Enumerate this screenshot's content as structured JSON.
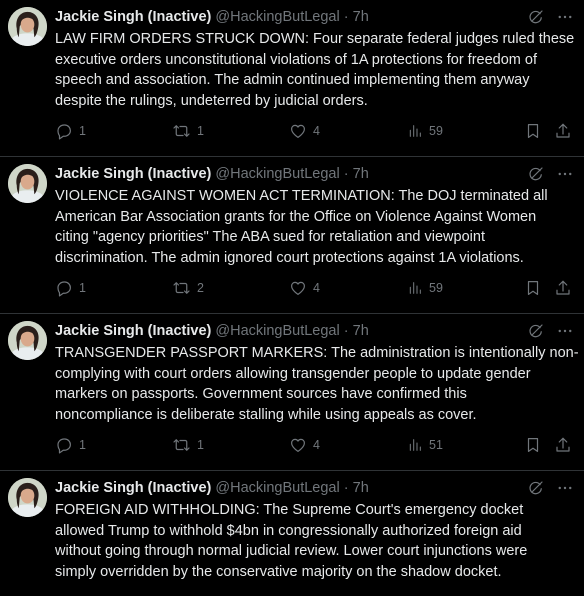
{
  "colors": {
    "background": "#000000",
    "text": "#e7e9ea",
    "muted": "#71767b",
    "divider": "#2f3336"
  },
  "tweets": [
    {
      "name": "Jackie Singh (Inactive)",
      "handle": "@HackingButLegal",
      "separator": "·",
      "time": "7h",
      "lines": [
        "LAW FIRM ORDERS STRUCK DOWN: Four separate federal judges ruled these",
        "executive orders unconstitutional violations of 1A protections for freedom of",
        "speech and association. The admin continued implementing them anyway",
        "despite the rulings, undeterred by judicial orders."
      ],
      "replies": "1",
      "reposts": "1",
      "likes": "4",
      "views": "59",
      "icons": [
        "grok-icon",
        "more-icon",
        "reply-icon",
        "repost-icon",
        "like-icon",
        "views-icon",
        "bookmark-icon",
        "share-icon"
      ]
    },
    {
      "name": "Jackie Singh (Inactive)",
      "handle": "@HackingButLegal",
      "separator": "·",
      "time": "7h",
      "lines": [
        "VIOLENCE AGAINST WOMEN ACT TERMINATION: The DOJ terminated all",
        "American Bar Association grants for the Office on Violence Against Women",
        "citing \"agency priorities\" The ABA sued for retaliation and viewpoint",
        "discrimination. The admin ignored court protections against 1A violations."
      ],
      "replies": "1",
      "reposts": "2",
      "likes": "4",
      "views": "59",
      "icons": [
        "grok-icon",
        "more-icon",
        "reply-icon",
        "repost-icon",
        "like-icon",
        "views-icon",
        "bookmark-icon",
        "share-icon"
      ]
    },
    {
      "name": "Jackie Singh (Inactive)",
      "handle": "@HackingButLegal",
      "separator": "·",
      "time": "7h",
      "lines": [
        "TRANSGENDER PASSPORT MARKERS: The administration is intentionally non-",
        "complying with court orders allowing transgender people to update gender",
        "markers on passports. Government sources have confirmed this",
        "noncompliance is deliberate stalling while using appeals as cover."
      ],
      "replies": "1",
      "reposts": "1",
      "likes": "4",
      "views": "51",
      "icons": [
        "grok-icon",
        "more-icon",
        "reply-icon",
        "repost-icon",
        "like-icon",
        "views-icon",
        "bookmark-icon",
        "share-icon"
      ]
    },
    {
      "name": "Jackie Singh (Inactive)",
      "handle": "@HackingButLegal",
      "separator": "·",
      "time": "7h",
      "lines": [
        "FOREIGN AID WITHHOLDING: The Supreme Court's emergency docket",
        "allowed Trump to withhold $4bn in congressionally authorized foreign aid",
        "without going through normal judicial review. Lower court injunctions were",
        "simply overridden by the conservative majority on the shadow docket."
      ],
      "icons": [
        "grok-icon",
        "more-icon"
      ]
    }
  ]
}
